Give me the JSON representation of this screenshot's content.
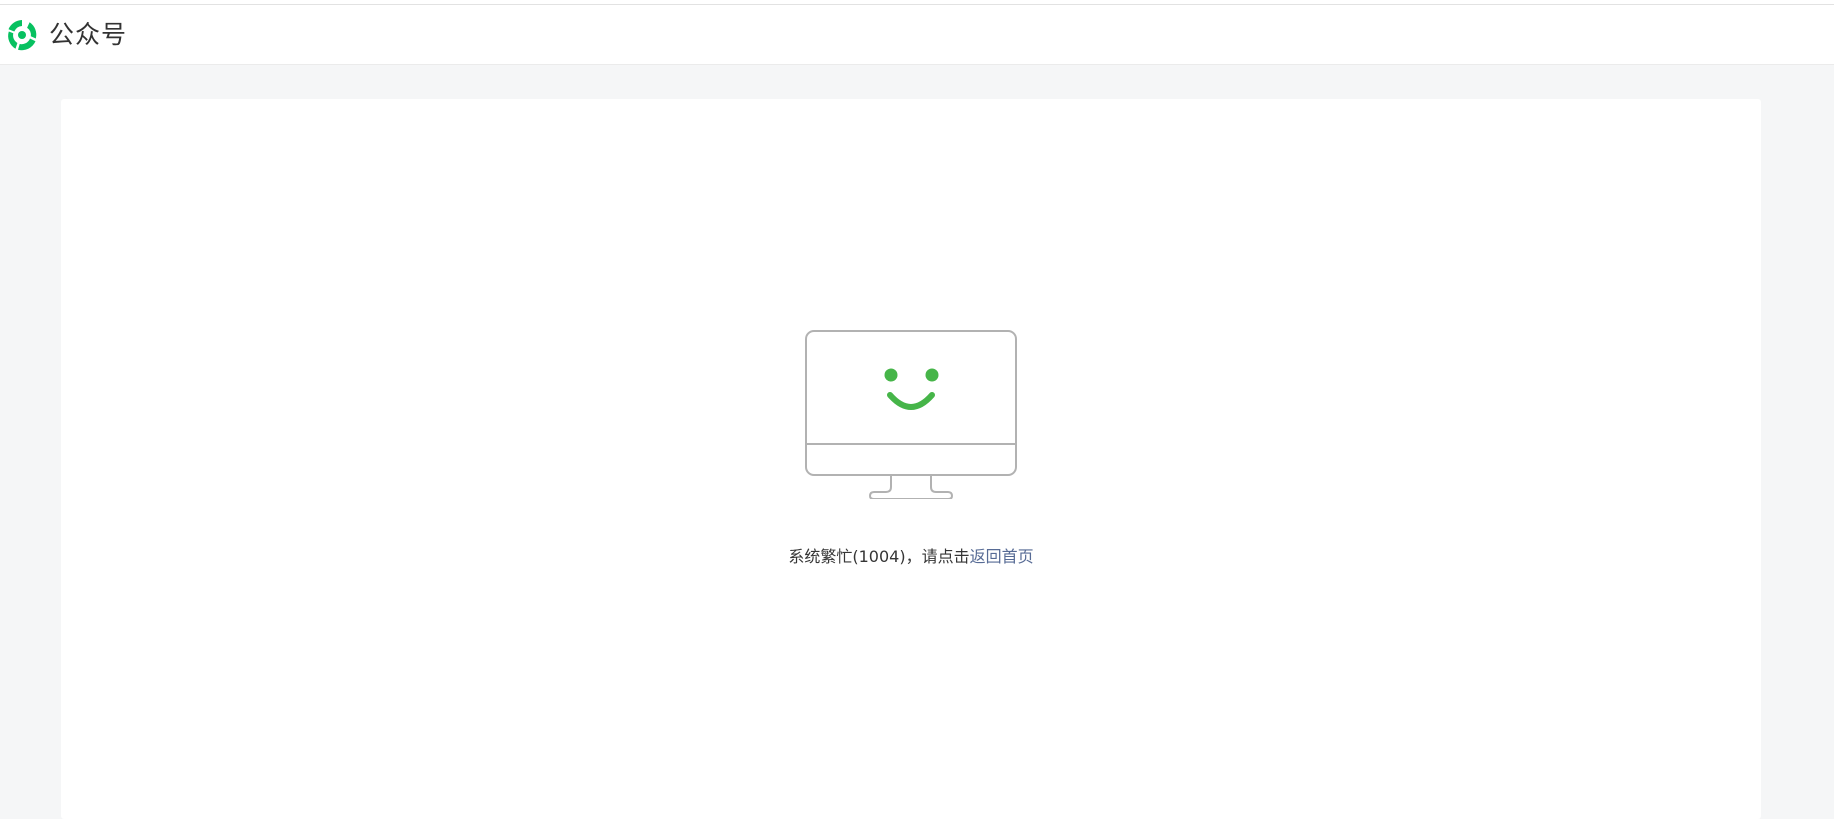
{
  "header": {
    "brand_name": "公众号",
    "logo_icon": "wechat-official-account-logo-icon"
  },
  "error": {
    "message_prefix": "系统繁忙(1004)，请点击",
    "link_label": "返回首页",
    "illustration_icon": "smiling-monitor-icon"
  },
  "colors": {
    "brand_green": "#07c160",
    "smile_green": "#46b549",
    "link_blue": "#576b95",
    "page_background": "#f5f6f7",
    "monitor_outline": "#b2b2b2"
  }
}
